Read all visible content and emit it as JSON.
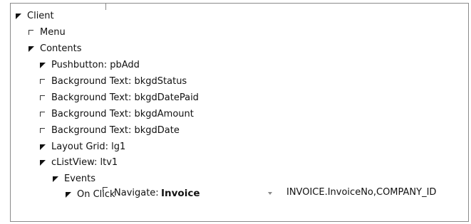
{
  "tree": {
    "client": "Client",
    "menu": "Menu",
    "contents": "Contents",
    "pushbutton": "Pushbutton: pbAdd",
    "bkgd_status": "Background Text: bkgdStatus",
    "bkgd_date_paid": "Background Text: bkgdDatePaid",
    "bkgd_amount": "Background Text: bkgdAmount",
    "bkgd_date": "Background Text: bkgdDate",
    "layout_grid": "Layout Grid: lg1",
    "clistview": "cListView: ltv1",
    "events": "Events",
    "on_click": "On Click",
    "navigate": "Navigate:"
  },
  "navigate": {
    "target": "Invoice",
    "params": "INVOICE.InvoiceNo,COMPANY_ID"
  },
  "icons": {
    "expanded": "expanded-triangle-icon",
    "collapsed": "collapsed-corner-icon",
    "dropdown": "dropdown-arrow-icon"
  }
}
